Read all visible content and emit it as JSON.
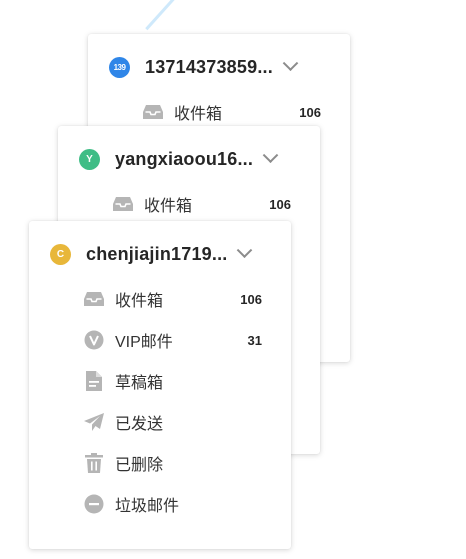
{
  "accounts": [
    {
      "name": "13714373859...",
      "avatar_text": "139",
      "avatar_color": "#2f86e8",
      "folders": [
        {
          "label": "收件箱",
          "count": "106",
          "icon": "inbox-icon"
        }
      ]
    },
    {
      "name": "yangxiaoou16...",
      "avatar_text": "Y",
      "avatar_color": "#3fbd86",
      "folders": [
        {
          "label": "收件箱",
          "count": "106",
          "icon": "inbox-icon"
        }
      ]
    },
    {
      "name": "chenjiajin1719...",
      "avatar_text": "C",
      "avatar_color": "#e8b73a",
      "folders": [
        {
          "label": "收件箱",
          "count": "106",
          "icon": "inbox-icon"
        },
        {
          "label": "VIP邮件",
          "count": "31",
          "icon": "vip-icon"
        },
        {
          "label": "草稿箱",
          "count": "",
          "icon": "draft-icon"
        },
        {
          "label": "已发送",
          "count": "",
          "icon": "sent-icon"
        },
        {
          "label": "已删除",
          "count": "",
          "icon": "trash-icon"
        },
        {
          "label": "垃圾邮件",
          "count": "",
          "icon": "spam-icon"
        }
      ]
    }
  ]
}
